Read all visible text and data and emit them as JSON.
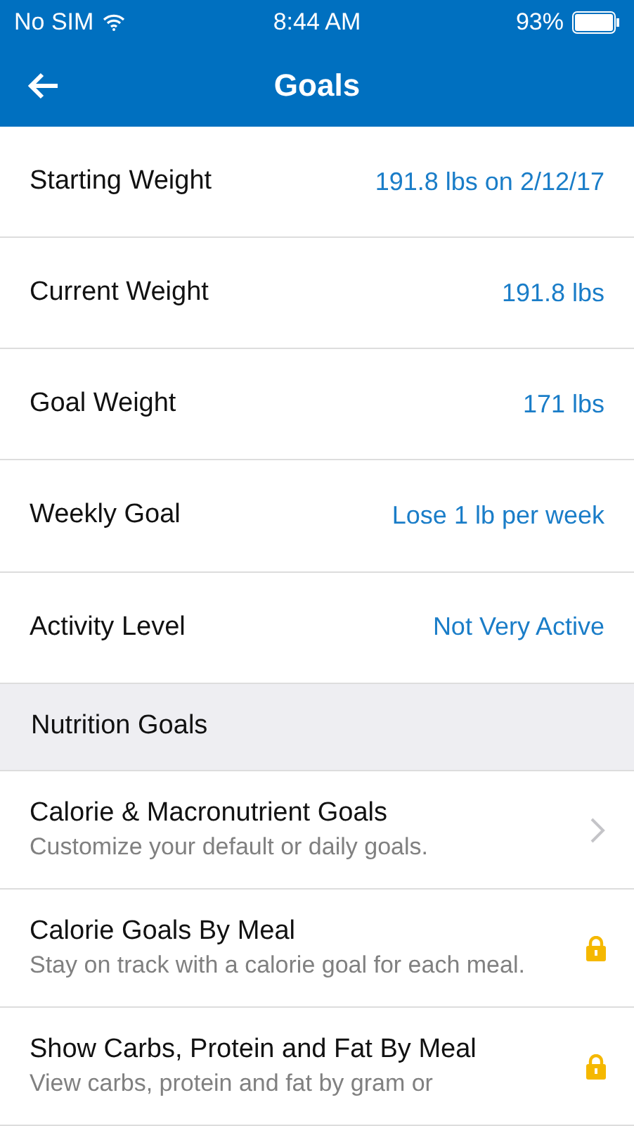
{
  "status_bar": {
    "carrier": "No SIM",
    "time": "8:44 AM",
    "battery": "93%"
  },
  "header": {
    "title": "Goals"
  },
  "goals": [
    {
      "label": "Starting Weight",
      "value": "191.8 lbs on 2/12/17"
    },
    {
      "label": "Current Weight",
      "value": "191.8 lbs"
    },
    {
      "label": "Goal Weight",
      "value": "171 lbs"
    },
    {
      "label": "Weekly Goal",
      "value": "Lose 1 lb per week"
    },
    {
      "label": "Activity Level",
      "value": "Not Very Active"
    }
  ],
  "section": {
    "title": "Nutrition Goals"
  },
  "nutrition_items": [
    {
      "kind": "link",
      "title": "Calorie & Macronutrient Goals",
      "subtitle": "Customize your default or daily goals."
    },
    {
      "kind": "locked",
      "title": "Calorie Goals By Meal",
      "subtitle": "Stay on track with a calorie goal for each meal."
    },
    {
      "kind": "locked",
      "title": "Show Carbs, Protein and Fat By Meal",
      "subtitle": "View carbs, protein and fat by gram or"
    }
  ]
}
